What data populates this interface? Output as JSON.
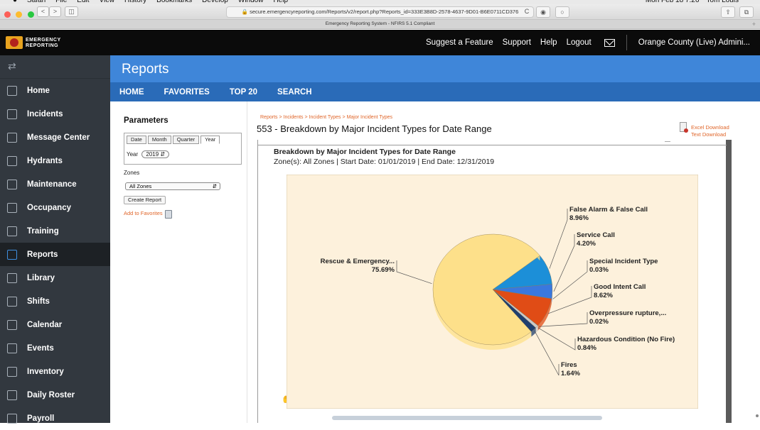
{
  "browser": {
    "url": "secure.emergencyreporting.com/Reports/v2/report.php?Reports_id=333E3B8D-2578-4637-9D01-B6E0711CD376",
    "tab_title": "Emergency Reporting System - NFIRS 5.1 Compliant",
    "nav_back": "<",
    "nav_forward": ">",
    "sidebar_btn": "◫",
    "reload": "C",
    "share": "⇧",
    "newtab": "+"
  },
  "header": {
    "logo_line1": "EMERGENCY",
    "logo_line2": "REPORTING",
    "links": [
      "Suggest a Feature",
      "Support",
      "Help",
      "Logout"
    ],
    "org": "Orange County (Live) Admini..."
  },
  "sidebar": {
    "toggle": "⇄",
    "items": [
      {
        "label": "Home",
        "icon": "home-icon"
      },
      {
        "label": "Incidents",
        "icon": "incidents-icon"
      },
      {
        "label": "Message Center",
        "icon": "envelope-icon"
      },
      {
        "label": "Hydrants",
        "icon": "hydrant-icon"
      },
      {
        "label": "Maintenance",
        "icon": "wrench-icon"
      },
      {
        "label": "Occupancy",
        "icon": "building-icon"
      },
      {
        "label": "Training",
        "icon": "training-icon"
      },
      {
        "label": "Reports",
        "icon": "reports-icon",
        "active": true
      },
      {
        "label": "Library",
        "icon": "library-icon"
      },
      {
        "label": "Shifts",
        "icon": "shifts-icon"
      },
      {
        "label": "Calendar",
        "icon": "calendar-icon"
      },
      {
        "label": "Events",
        "icon": "events-icon"
      },
      {
        "label": "Inventory",
        "icon": "inventory-icon"
      },
      {
        "label": "Daily Roster",
        "icon": "roster-icon"
      },
      {
        "label": "Payroll",
        "icon": "payroll-icon"
      }
    ]
  },
  "page": {
    "title": "Reports",
    "subnav": [
      "HOME",
      "FAVORITES",
      "TOP 20",
      "SEARCH"
    ]
  },
  "params": {
    "heading": "Parameters",
    "tabs": [
      "Date",
      "Month",
      "Quarter",
      "Year"
    ],
    "selected_tab": "Year",
    "year_label": "Year",
    "year_value": "2019",
    "zones_label": "Zones",
    "zones_value": "All Zones",
    "create_button": "Create Report",
    "add_favorites": "Add to Favorites"
  },
  "report": {
    "breadcrumb": [
      "Reports",
      "Incidents",
      "Incident Types",
      "Major Incident Types"
    ],
    "breadcrumb_sep": ">",
    "title": "553 - Breakdown by Major Incident Types for Date Range",
    "excel_download": "Excel Download",
    "text_download": "Text Download",
    "chart_title": "Breakdown by Major Incident Types for Date Range",
    "chart_subtitle": "Zone(s): All Zones | Start Date: 01/01/2019 | End Date: 12/31/2019"
  },
  "chart_data": {
    "type": "pie",
    "title": "Breakdown by Major Incident Types for Date Range",
    "subtitle": "Zone(s): All Zones | Start Date: 01/01/2019 | End Date: 12/31/2019",
    "background": "#fdf1dc",
    "slices": [
      {
        "name": "False Alarm & False Call",
        "value": 8.96,
        "label": "8.96%",
        "color": "#1c8fd8"
      },
      {
        "name": "Service Call",
        "value": 4.2,
        "label": "4.20%",
        "color": "#3a78de"
      },
      {
        "name": "Special Incident Type",
        "value": 0.03,
        "label": "0.03%",
        "color": "#8fb3e6"
      },
      {
        "name": "Good Intent Call",
        "value": 8.62,
        "label": "8.62%",
        "color": "#e04c16"
      },
      {
        "name": "Overpressure  rupture,...",
        "value": 0.02,
        "label": "0.02%",
        "color": "#f08a5a"
      },
      {
        "name": "Hazardous Condition (No Fire)",
        "value": 0.84,
        "label": "0.84%",
        "color": "#c9c9c9"
      },
      {
        "name": "Fires",
        "value": 1.64,
        "label": "1.64%",
        "color": "#1f3f6e"
      },
      {
        "name": "Rescue & Emergency...",
        "value": 75.69,
        "label": "75.69%",
        "color": "#fde08a"
      }
    ]
  }
}
